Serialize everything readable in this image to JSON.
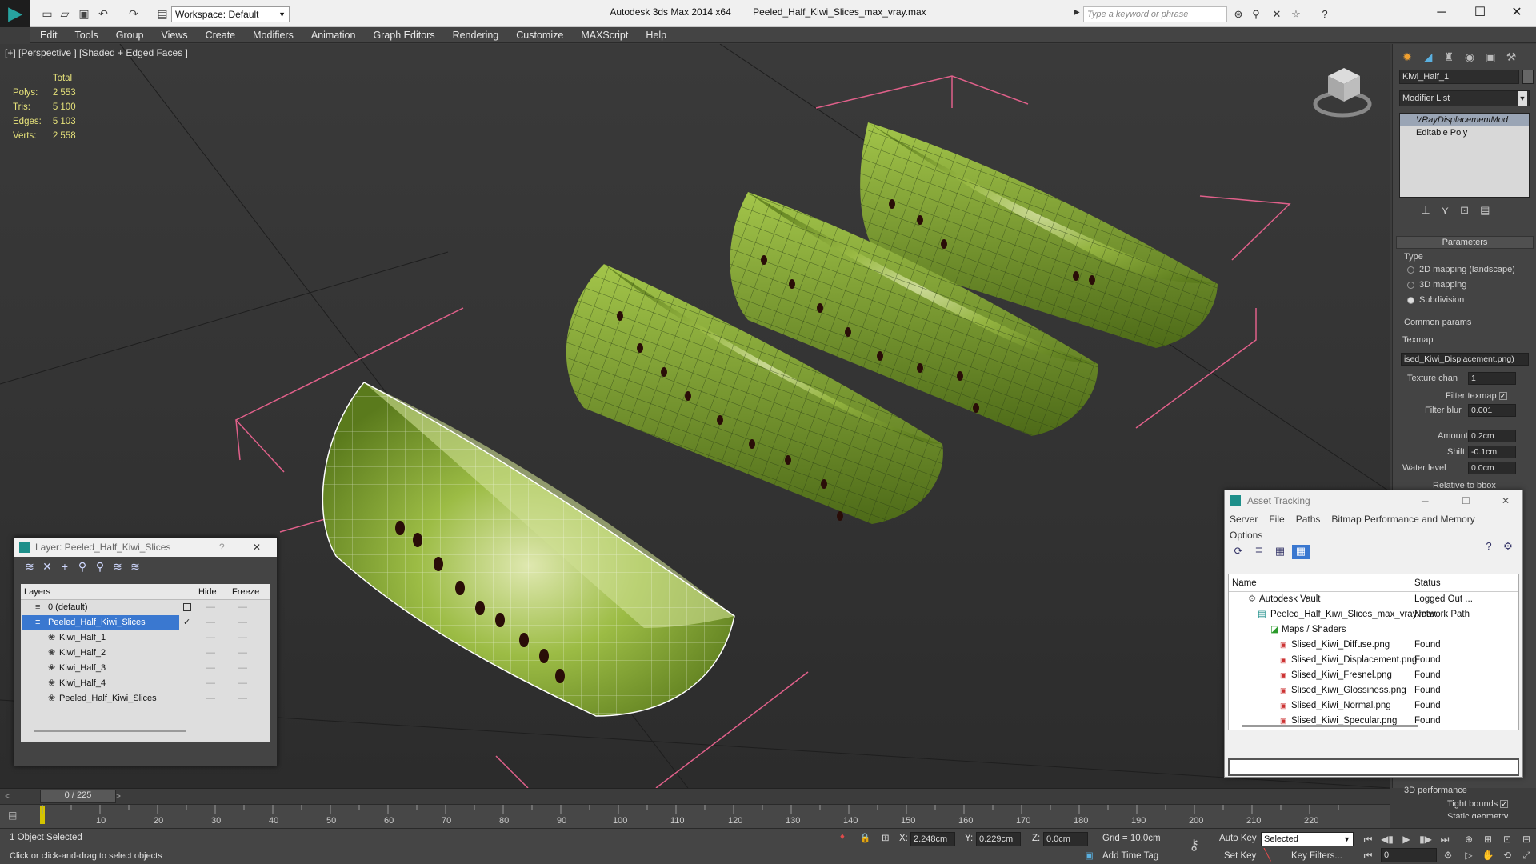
{
  "app": {
    "name": "Autodesk 3ds Max  2014 x64",
    "file": "Peeled_Half_Kiwi_Slices_max_vray.max",
    "workspace": "Workspace: Default",
    "search_placeholder": "Type a keyword or phrase"
  },
  "menu": [
    "Edit",
    "Tools",
    "Group",
    "Views",
    "Create",
    "Modifiers",
    "Animation",
    "Graph Editors",
    "Rendering",
    "Customize",
    "MAXScript",
    "Help"
  ],
  "viewport": {
    "label": "[+] [Perspective ] [Shaded + Edged Faces ]",
    "stats": {
      "header": "Total",
      "rows": [
        {
          "label": "Polys:",
          "value": "2 553"
        },
        {
          "label": "Tris:",
          "value": "5 100"
        },
        {
          "label": "Edges:",
          "value": "5 103"
        },
        {
          "label": "Verts:",
          "value": "2 558"
        }
      ]
    }
  },
  "command_panel": {
    "object_name": "Kiwi_Half_1",
    "modifier_list": "Modifier List",
    "stack": [
      "VRayDisplacementMod",
      "Editable Poly"
    ],
    "rollout_title": "Parameters",
    "type_label": "Type",
    "type_options": [
      "2D mapping (landscape)",
      "3D mapping",
      "Subdivision"
    ],
    "common_params": "Common params",
    "texmap_label": "Texmap",
    "texmap_value": "ised_Kiwi_Displacement.png)",
    "texture_chan_label": "Texture chan",
    "texture_chan_value": "1",
    "filter_texmap_label": "Filter texmap",
    "filter_blur_label": "Filter blur",
    "filter_blur_value": "0.001",
    "amount_label": "Amount",
    "amount_value": "0.2cm",
    "shift_label": "Shift",
    "shift_value": "-0.1cm",
    "water_label": "Water level",
    "water_value": "0.0cm",
    "relative_label": "Relative to bbox",
    "perf_label": "3D performance",
    "tight_label": "Tight bounds",
    "static_label": "Static geometry"
  },
  "layer_window": {
    "title": "Layer: Peeled_Half_Kiwi_Slices",
    "col_layers": "Layers",
    "col_hide": "Hide",
    "col_freeze": "Freeze",
    "rows": [
      {
        "name": "0 (default)",
        "indent": 1
      },
      {
        "name": "Peeled_Half_Kiwi_Slices",
        "indent": 1
      },
      {
        "name": "Kiwi_Half_1",
        "indent": 2
      },
      {
        "name": "Kiwi_Half_2",
        "indent": 2
      },
      {
        "name": "Kiwi_Half_3",
        "indent": 2
      },
      {
        "name": "Kiwi_Half_4",
        "indent": 2
      },
      {
        "name": "Peeled_Half_Kiwi_Slices",
        "indent": 2
      }
    ]
  },
  "asset_window": {
    "title": "Asset Tracking",
    "menu": [
      "Server",
      "File",
      "Paths",
      "Bitmap Performance and Memory"
    ],
    "menu2": "Options",
    "col_name": "Name",
    "col_status": "Status",
    "rows": [
      {
        "name": "Autodesk Vault",
        "status": "Logged Out ...",
        "level": 1
      },
      {
        "name": "Peeled_Half_Kiwi_Slices_max_vray.max",
        "status": "Network Path",
        "level": 2
      },
      {
        "name": "Maps / Shaders",
        "status": "",
        "level": 3
      },
      {
        "name": "Slised_Kiwi_Diffuse.png",
        "status": "Found",
        "level": 4
      },
      {
        "name": "Slised_Kiwi_Displacement.png",
        "status": "Found",
        "level": 4
      },
      {
        "name": "Slised_Kiwi_Fresnel.png",
        "status": "Found",
        "level": 4
      },
      {
        "name": "Slised_Kiwi_Glossiness.png",
        "status": "Found",
        "level": 4
      },
      {
        "name": "Slised_Kiwi_Normal.png",
        "status": "Found",
        "level": 4
      },
      {
        "name": "Slised_Kiwi_Specular.png",
        "status": "Found",
        "level": 4
      }
    ]
  },
  "timeline": {
    "frame_counter": "0 / 225",
    "ticks": [
      "0",
      "10",
      "20",
      "30",
      "40",
      "50",
      "60",
      "70",
      "80",
      "90",
      "100",
      "110",
      "120",
      "130",
      "140",
      "150",
      "160",
      "170",
      "180",
      "190",
      "200",
      "210",
      "220"
    ]
  },
  "status": {
    "selection": "1 Object Selected",
    "prompt": "Click or click-and-drag to select objects",
    "x_label": "X:",
    "x_value": "2.248cm",
    "y_label": "Y:",
    "y_value": "0.229cm",
    "z_label": "Z:",
    "z_value": "0.0cm",
    "grid": "Grid = 10.0cm",
    "add_time_tag": "Add Time Tag",
    "auto_key": "Auto Key",
    "set_key": "Set Key",
    "selected": "Selected",
    "key_filters": "Key Filters...",
    "frame": "0"
  },
  "colors": {
    "stats_yellow": "#e6e27a",
    "kiwi_green": "#7fa12c",
    "bbox_pink": "#e0608a",
    "selection_blue": "#3a78d0"
  }
}
